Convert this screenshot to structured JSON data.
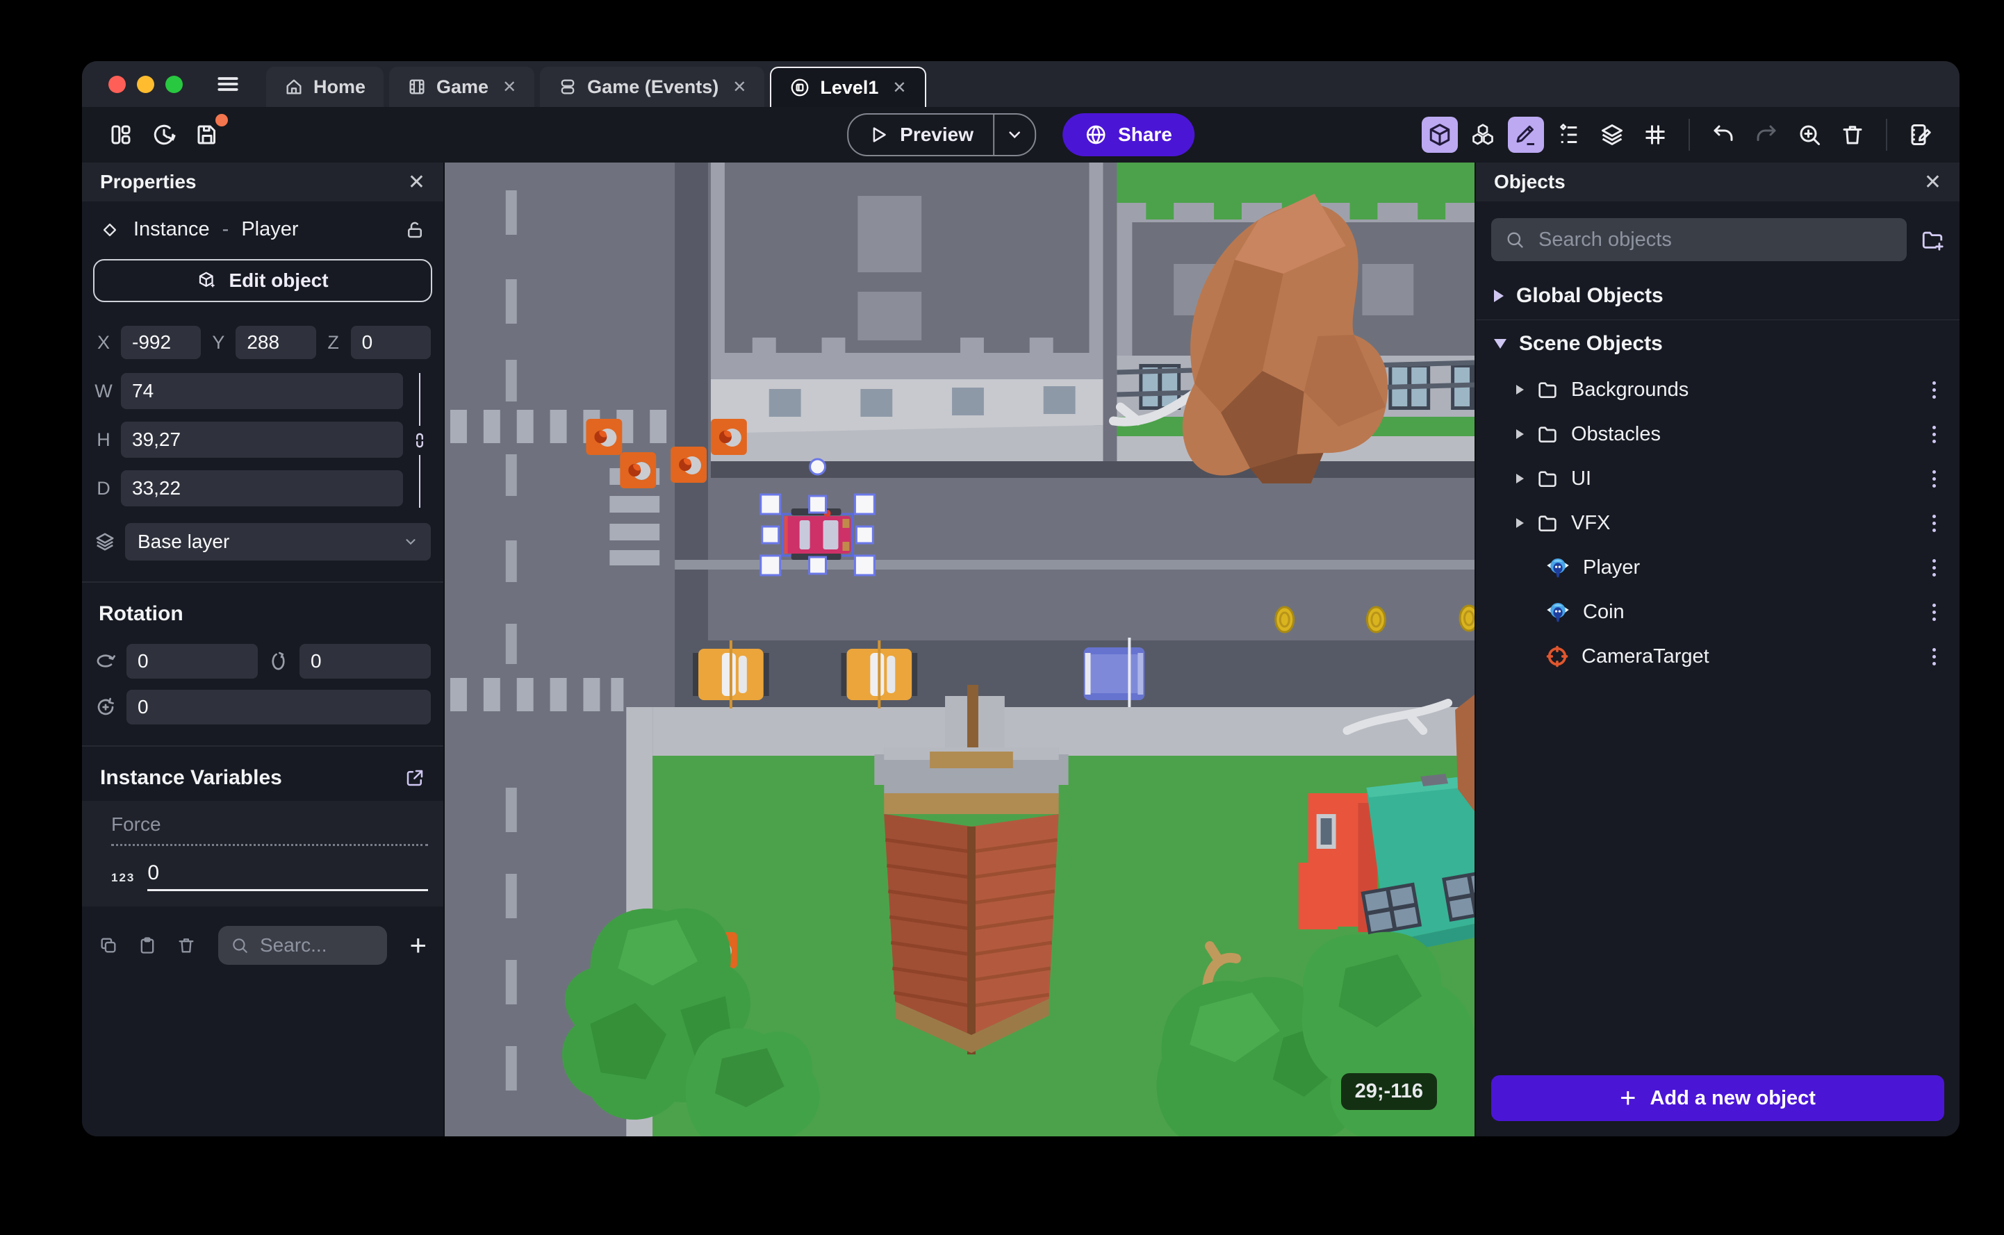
{
  "titlebar": {
    "tabs": [
      {
        "label": "Home",
        "icon": "home-icon",
        "active": false,
        "closable": false
      },
      {
        "label": "Game",
        "icon": "film-icon",
        "active": false,
        "closable": true
      },
      {
        "label": "Game (Events)",
        "icon": "events-icon",
        "active": false,
        "closable": true
      },
      {
        "label": "Level1",
        "icon": "scene-icon",
        "active": true,
        "closable": true
      }
    ]
  },
  "toolbar": {
    "preview_label": "Preview",
    "share_label": "Share",
    "left_icons": [
      "layout-icon",
      "history-icon",
      "save-icon"
    ],
    "right_icons": [
      "cube-3d-icon",
      "objects-stack-icon",
      "pencil-icon",
      "instances-list-icon",
      "layers-icon",
      "grid-icon",
      "undo-icon",
      "redo-icon",
      "zoom-in-icon",
      "trash-icon",
      "scene-editor-icon"
    ],
    "save_has_unsaved_changes_dot": true
  },
  "properties_panel": {
    "title": "Properties",
    "instance_kind": "Instance",
    "instance_separator": "-",
    "instance_name": "Player",
    "edit_object_label": "Edit object",
    "position": {
      "x_label": "X",
      "x_value": "-992",
      "y_label": "Y",
      "y_value": "288",
      "z_label": "Z",
      "z_value": "0"
    },
    "size": {
      "w_label": "W",
      "w_value": "74",
      "h_label": "H",
      "h_value": "39,27",
      "d_label": "D",
      "d_value": "33,22"
    },
    "layer_value": "Base layer",
    "rotation": {
      "title": "Rotation",
      "x_value": "0",
      "y_value": "0",
      "z_value": "0"
    },
    "instance_variables": {
      "title": "Instance Variables",
      "variable_name": "Force",
      "variable_type_badge": "123",
      "variable_value": "0",
      "search_placeholder": "Searc..."
    }
  },
  "canvas": {
    "cursor_coordinates": "29;-116"
  },
  "objects_panel": {
    "title": "Objects",
    "search_placeholder": "Search objects",
    "global_group_label": "Global Objects",
    "scene_group_label": "Scene Objects",
    "folders": [
      "Backgrounds",
      "Obstacles",
      "UI",
      "VFX"
    ],
    "objects": [
      {
        "name": "Player",
        "icon": "monkey-3d-icon"
      },
      {
        "name": "Coin",
        "icon": "monkey-3d-icon"
      },
      {
        "name": "CameraTarget",
        "icon": "camera-target-icon"
      }
    ],
    "add_button_label": "Add a new object"
  },
  "icons": {
    "close": "✕",
    "plus": "+"
  },
  "colors": {
    "accent_purple": "#4B15D6",
    "active_tool_background": "#BCA9F2",
    "selection_blue": "#5B6AE0",
    "traffic_red": "#FF5F57",
    "traffic_yellow": "#FEBC2E",
    "traffic_green": "#28C840",
    "unsaved_dot_orange": "#F4764E",
    "grass_green": "#4CA24A"
  }
}
